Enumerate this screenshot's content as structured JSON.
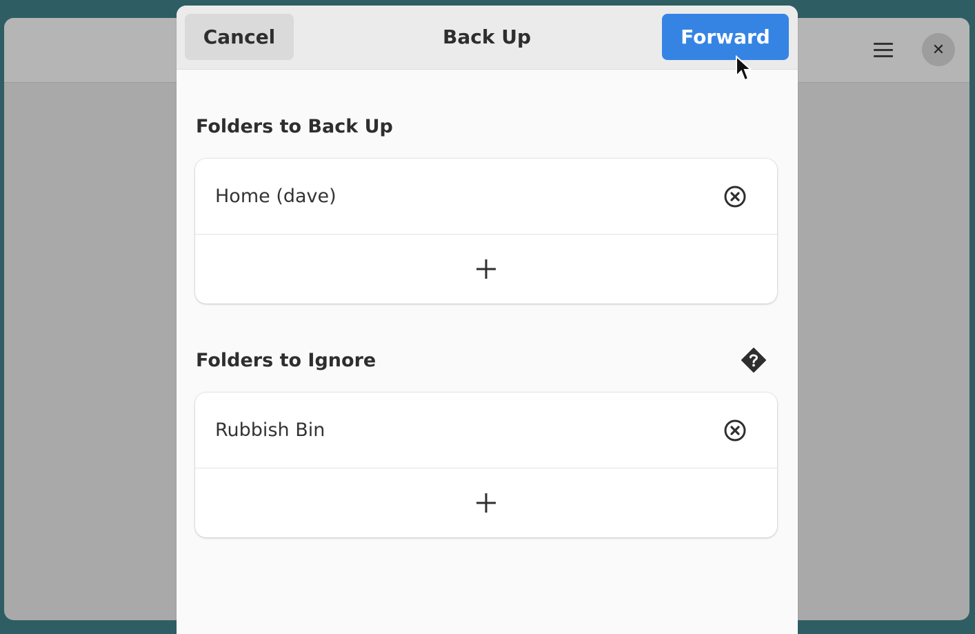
{
  "dialog": {
    "title": "Back Up",
    "cancel_label": "Cancel",
    "forward_label": "Forward"
  },
  "backup_section": {
    "title": "Folders to Back Up",
    "items": [
      {
        "label": "Home (dave)"
      }
    ]
  },
  "ignore_section": {
    "title": "Folders to Ignore",
    "items": [
      {
        "label": "Rubbish Bin"
      }
    ]
  },
  "colors": {
    "accent": "#3584e4",
    "dialog_bg": "#fafafa",
    "header_bg": "#ebebeb"
  },
  "icons": {
    "menu": "hamburger-menu-icon",
    "close": "close-icon",
    "help": "help-icon",
    "remove": "remove-circle-icon",
    "add": "plus-icon"
  }
}
